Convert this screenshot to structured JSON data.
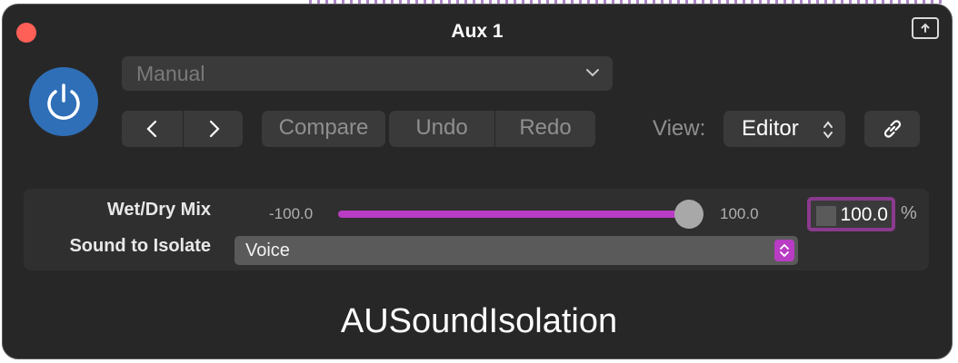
{
  "window": {
    "title": "Aux 1"
  },
  "preset": {
    "value": "Manual"
  },
  "toolbar": {
    "compare_label": "Compare",
    "undo_label": "Undo",
    "redo_label": "Redo",
    "view_label": "View:",
    "view_value": "Editor"
  },
  "params": {
    "wet_dry": {
      "label": "Wet/Dry Mix",
      "min_label": "-100.0",
      "max_label": "100.0",
      "value": "100.0",
      "unit": "%"
    },
    "sound_to_isolate": {
      "label": "Sound to Isolate",
      "value": "Voice"
    }
  },
  "plugin": {
    "name": "AUSoundIsolation"
  },
  "colors": {
    "window_bg": "#272727",
    "power_blue": "#2f6fb8",
    "accent_purple": "#b93cc4",
    "close_red": "#fe5f57"
  }
}
